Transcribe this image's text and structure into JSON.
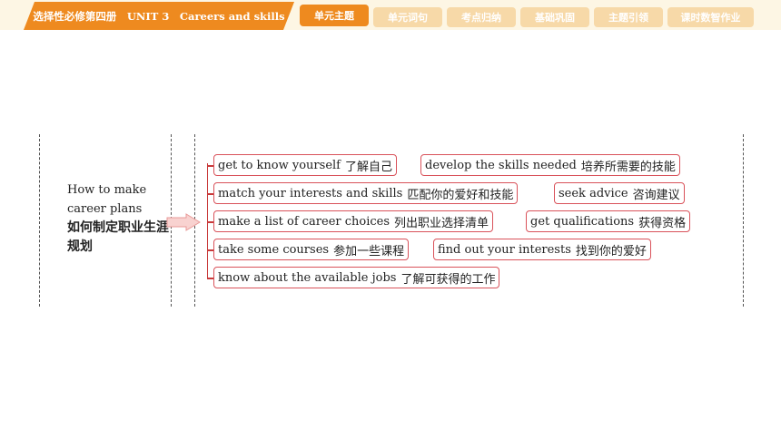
{
  "header": {
    "title": "选择性必修第四册　UNIT 3　Careers and skills",
    "nav": [
      {
        "label": "单元主题",
        "active": true
      },
      {
        "label": "单元词句",
        "active": false
      },
      {
        "label": "考点归纳",
        "active": false
      },
      {
        "label": "基础巩固",
        "active": false
      },
      {
        "label": "主题引领",
        "active": false
      },
      {
        "label": "课时数智作业",
        "active": false
      }
    ]
  },
  "topic": {
    "en": "How to make career plans",
    "zh": "如何制定职业生涯规划"
  },
  "items": [
    {
      "en": "get to know yourself",
      "zh": "了解自己"
    },
    {
      "en": "develop the skills needed",
      "zh": "培养所需要的技能"
    },
    {
      "en": "match your interests and skills",
      "zh": "匹配你的爱好和技能"
    },
    {
      "en": "seek advice",
      "zh": "咨询建议"
    },
    {
      "en": "make a list of career choices",
      "zh": "列出职业选择清单"
    },
    {
      "en": "get qualifications",
      "zh": "获得资格"
    },
    {
      "en": "take some courses",
      "zh": "参加一些课程"
    },
    {
      "en": "find out your interests",
      "zh": "找到你的爱好"
    },
    {
      "en": "know about the available jobs",
      "zh": "了解可获得的工作"
    }
  ]
}
